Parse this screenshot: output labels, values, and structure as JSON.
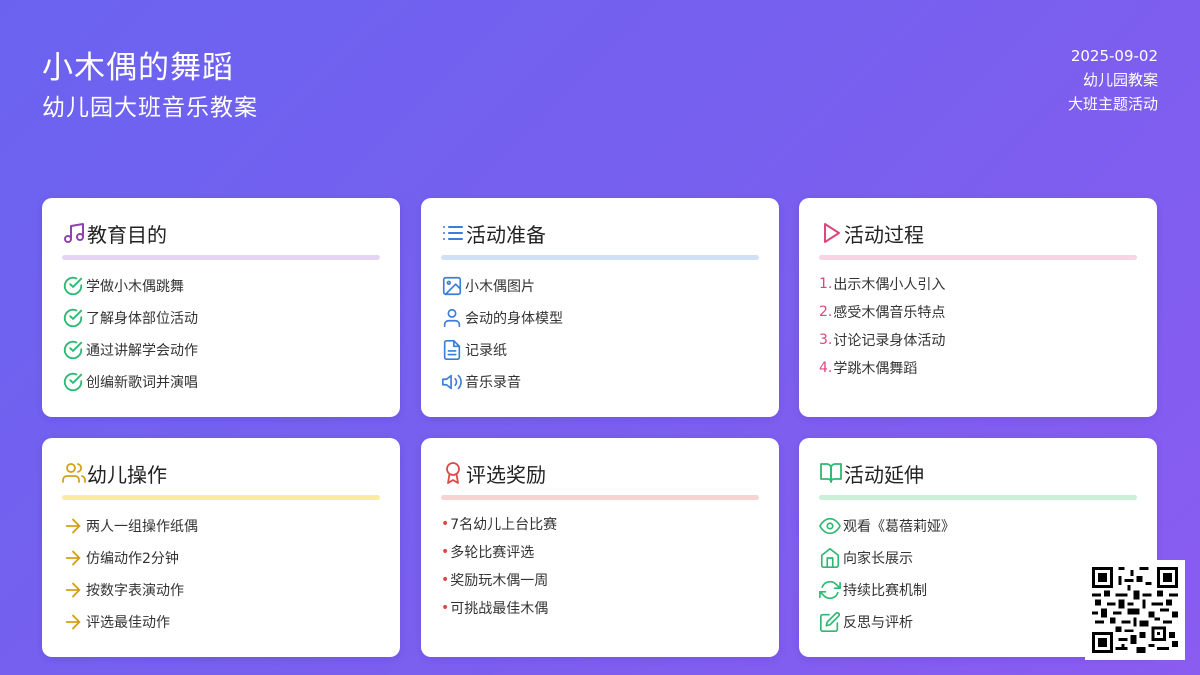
{
  "header": {
    "title": "小木偶的舞蹈",
    "subtitle": "幼儿园大班音乐教案",
    "date": "2025-09-02",
    "category": "幼儿园教案",
    "topic": "大班主题活动"
  },
  "cards": {
    "goals": {
      "title": "教育目的",
      "icon": "music-note-icon",
      "accent": "#8e44ad",
      "rule_color": "#e6d4f5",
      "items": [
        "学做小木偶跳舞",
        "了解身体部位活动",
        "通过讲解学会动作",
        "创编新歌词并演唱"
      ]
    },
    "prep": {
      "title": "活动准备",
      "icon": "list-icon",
      "accent": "#3b7dd8",
      "rule_color": "#cfe0f7",
      "items": [
        "小木偶图片",
        "会动的身体模型",
        "记录纸",
        "音乐录音"
      ]
    },
    "process": {
      "title": "活动过程",
      "icon": "play-icon",
      "accent": "#e0457b",
      "rule_color": "#f9d5e3",
      "items": [
        "出示木偶小人引入",
        "感受木偶音乐特点",
        "讨论记录身体活动",
        "学跳木偶舞蹈"
      ],
      "numbers": [
        "1.",
        "2.",
        "3.",
        "4."
      ]
    },
    "practice": {
      "title": "幼儿操作",
      "icon": "users-icon",
      "accent": "#d4a017",
      "rule_color": "#fbeda0",
      "items": [
        "两人一组操作纸偶",
        "仿编动作2分钟",
        "按数字表演动作",
        "评选最佳动作"
      ]
    },
    "awards": {
      "title": "评选奖励",
      "icon": "award-icon",
      "accent": "#e04848",
      "rule_color": "#f9d2d2",
      "items": [
        "7名幼儿上台比赛",
        "多轮比赛评选",
        "奖励玩木偶一周",
        "可挑战最佳木偶"
      ],
      "bullet": "•"
    },
    "extension": {
      "title": "活动延伸",
      "icon": "book-icon",
      "accent": "#2eb872",
      "rule_color": "#c9f1d8",
      "items": [
        "观看《葛蓓莉娅》",
        "向家长展示",
        "持续比赛机制",
        "反思与评析"
      ]
    }
  }
}
